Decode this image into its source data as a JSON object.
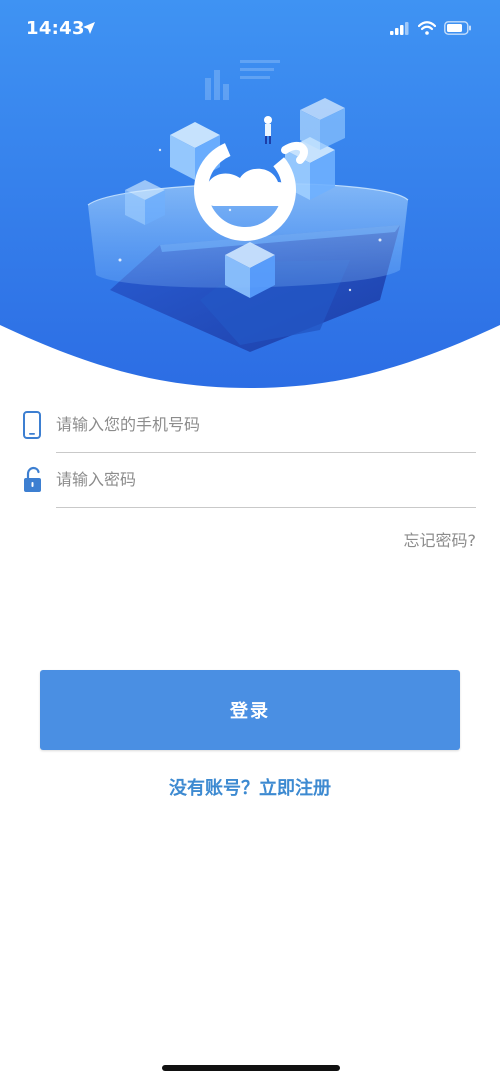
{
  "status_bar": {
    "time": "14:43",
    "icons": [
      "location-arrow-icon",
      "signal-icon",
      "wifi-icon",
      "battery-icon"
    ]
  },
  "hero": {
    "gradient_top": "#3b8cf0",
    "gradient_bottom": "#2f6fe6",
    "logo_icon": "cloud-swirl-logo-icon"
  },
  "form": {
    "phone": {
      "placeholder": "请输入您的手机号码",
      "value": "",
      "icon": "mobile-phone-icon"
    },
    "password": {
      "placeholder": "请输入密码",
      "value": "",
      "icon": "unlock-icon"
    },
    "forgot_label": "忘记密码?"
  },
  "actions": {
    "login_label": "登录",
    "register_label": "没有账号？立即注册"
  },
  "colors": {
    "accent": "#4a8fe3",
    "link": "#3d8ad1",
    "icon": "#3d7fd1"
  }
}
